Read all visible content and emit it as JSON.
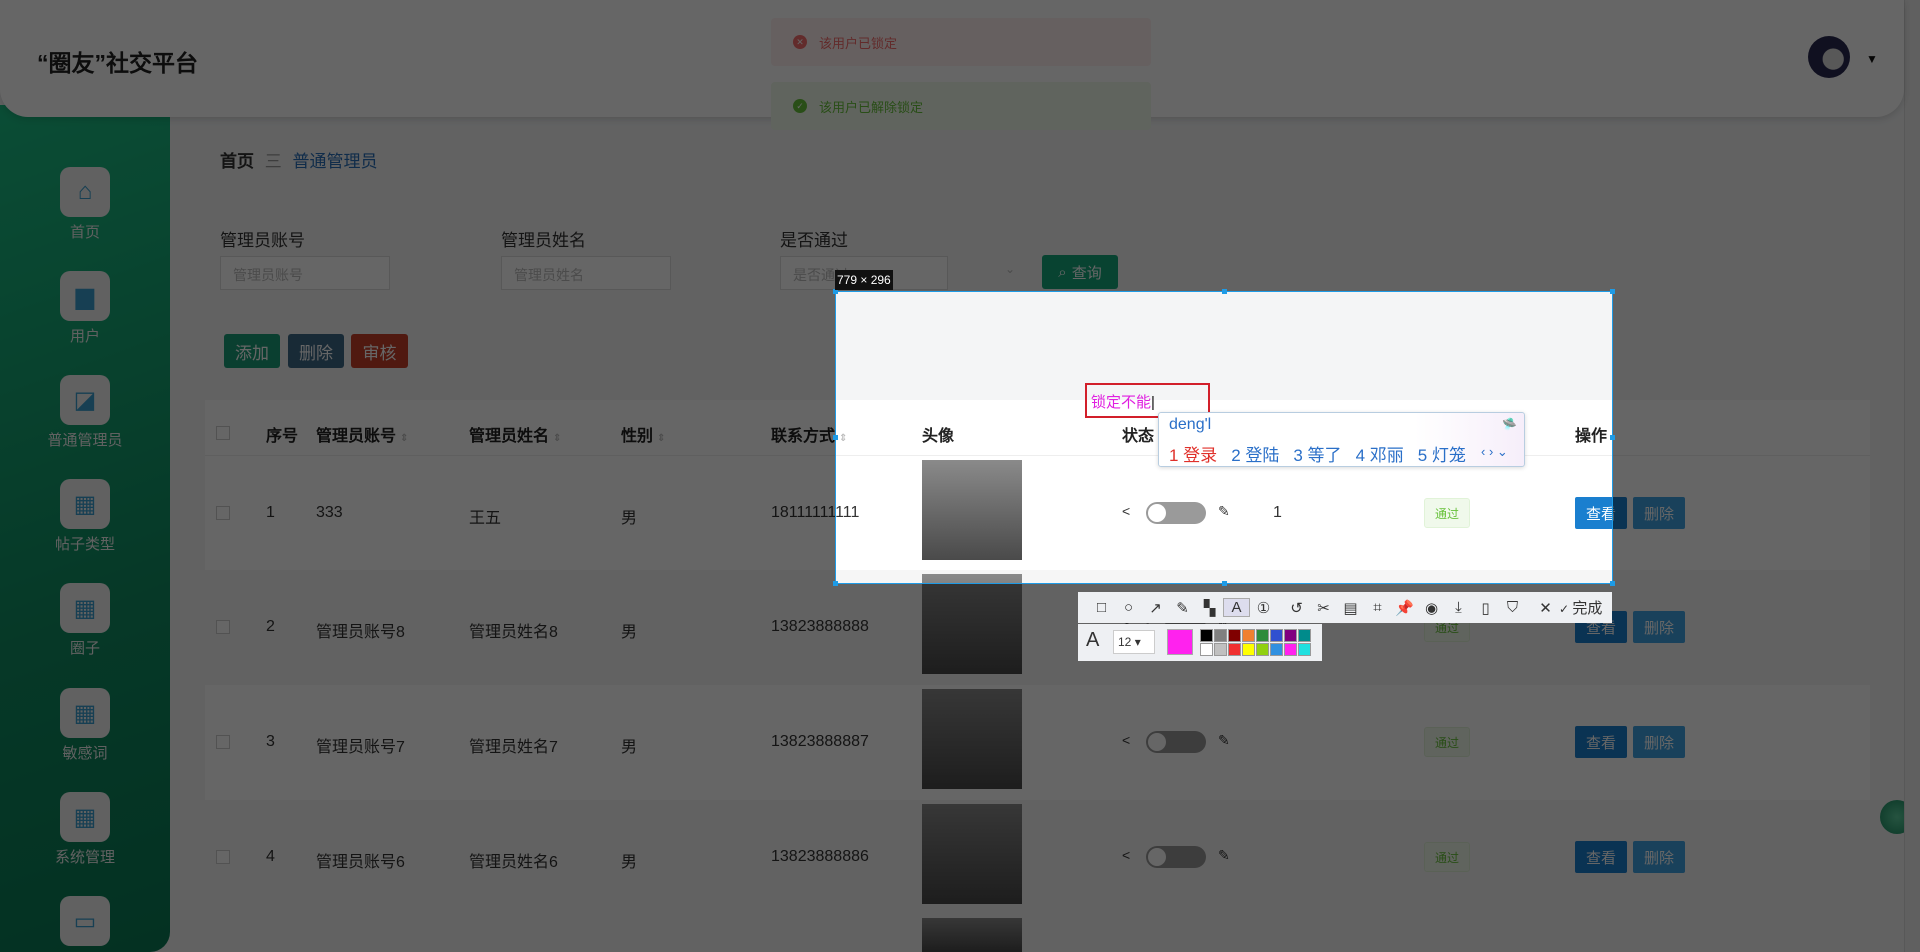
{
  "header": {
    "title": "“圈友”社交平台"
  },
  "sidebar": {
    "items": [
      {
        "label": "首页",
        "icon": "home-icon"
      },
      {
        "label": "用户",
        "icon": "user-icon"
      },
      {
        "label": "普通管理员",
        "icon": "chart-icon"
      },
      {
        "label": "帖子类型",
        "icon": "grid-icon"
      },
      {
        "label": "圈子",
        "icon": "grid-icon"
      },
      {
        "label": "敏感词",
        "icon": "grid-icon"
      },
      {
        "label": "系统管理",
        "icon": "grid-icon"
      },
      {
        "label": "",
        "icon": "window-icon"
      }
    ]
  },
  "toasts": [
    {
      "type": "error",
      "text": "该用户已锁定",
      "color": "#f56c6c"
    },
    {
      "type": "success",
      "text": "该用户已解除锁定",
      "color": "#67c23a"
    }
  ],
  "breadcrumb": {
    "home": "首页",
    "sep": "三",
    "current": "普通管理员"
  },
  "search": {
    "account_label": "管理员账号",
    "account_placeholder": "管理员账号",
    "name_label": "管理员姓名",
    "name_placeholder": "管理员姓名",
    "pass_label": "是否通过",
    "pass_placeholder": "是否通过",
    "query": "查询"
  },
  "actions": {
    "add": "添加",
    "delete": "删除",
    "review": "审核"
  },
  "table": {
    "headers": {
      "seq": "序号",
      "account": "管理员账号",
      "name": "管理员姓名",
      "sex": "性别",
      "phone": "联系方式",
      "avatar": "头像",
      "status": "状态",
      "ops": "操作"
    },
    "rows": [
      {
        "seq": "1",
        "account": "333",
        "name": "王五",
        "sex": "男",
        "phone": "18111111111",
        "count": "1",
        "tag": "通过"
      },
      {
        "seq": "2",
        "account": "管理员账号8",
        "name": "管理员姓名8",
        "sex": "男",
        "phone": "13823888888",
        "count": "",
        "tag": "通过"
      },
      {
        "seq": "3",
        "account": "管理员账号7",
        "name": "管理员姓名7",
        "sex": "男",
        "phone": "13823888887",
        "count": "",
        "tag": "通过"
      },
      {
        "seq": "4",
        "account": "管理员账号6",
        "name": "管理员姓名6",
        "sex": "男",
        "phone": "13823888886",
        "count": "",
        "tag": "通过"
      }
    ],
    "view": "查看",
    "delete": "删除"
  },
  "capture": {
    "size": "779 × 296",
    "annotation_text": "锁定不能",
    "done": "完成",
    "font_size": "12",
    "current_color": "#ff22ee",
    "palette": [
      "#000000",
      "#808080",
      "#800000",
      "#f08030",
      "#2e8b3a",
      "#3050d0",
      "#800080",
      "#008b8b",
      "#ffffff",
      "#c0c0c0",
      "#f03030",
      "#ffff00",
      "#90d010",
      "#3090e0",
      "#ff22ee",
      "#20e0e0"
    ]
  },
  "ime": {
    "pinyin": "deng'l",
    "candidates": [
      "1 登录",
      "2 登陆",
      "3 等了",
      "4 邓丽",
      "5 灯笼"
    ]
  }
}
